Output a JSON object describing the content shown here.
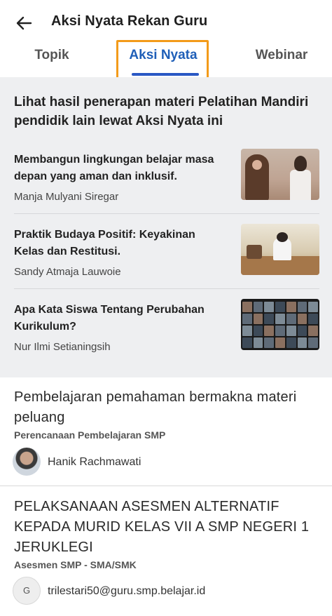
{
  "header": {
    "title": "Aksi Nyata Rekan Guru",
    "back_icon": "arrow-left-icon"
  },
  "tabs": [
    {
      "label": "Topik",
      "selected": false
    },
    {
      "label": "Aksi Nyata",
      "selected": true
    },
    {
      "label": "Webinar",
      "selected": false
    }
  ],
  "colors": {
    "accent": "#2a58c4",
    "highlight_box": "#f39b1a",
    "section_background": "#eeeff1"
  },
  "featured": {
    "heading": "Lihat hasil penerapan materi Pelatihan Mandiri pendidik lain lewat Aksi Nyata ini",
    "items": [
      {
        "title": "Membangun lingkungan belajar masa depan yang aman dan inklusif.",
        "author": "Manja Mulyani Siregar"
      },
      {
        "title": "Praktik Budaya Positif: Keyakinan Kelas dan Restitusi.",
        "author": "Sandy Atmaja Lauwoie"
      },
      {
        "title": "Apa Kata Siswa Tentang Perubahan Kurikulum?",
        "author": "Nur Ilmi Setianingsih"
      }
    ]
  },
  "posts": [
    {
      "title": "Pembelajaran pemahaman bermakna materi peluang",
      "category": "Perencanaan Pembelajaran SMP",
      "author": "Hanik Rachmawati",
      "avatar_type": "photo"
    },
    {
      "title": "PELAKSANAAN ASESMEN ALTERNATIF KEPADA MURID KELAS VII A SMP NEGERI 1 JERUKLEGI",
      "category": "Asesmen SMP - SMA/SMK",
      "author": "trilestari50@guru.smp.belajar.id",
      "avatar_letter": "G"
    }
  ]
}
